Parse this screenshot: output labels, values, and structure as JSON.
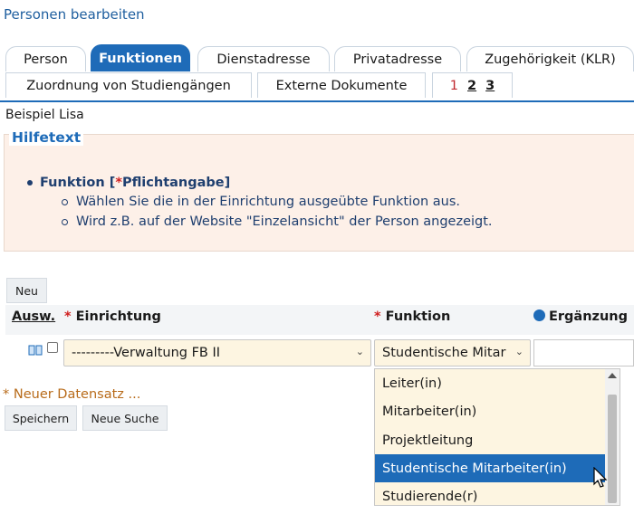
{
  "page_title": "Personen bearbeiten",
  "tabs": [
    {
      "label": "Person"
    },
    {
      "label": "Funktionen"
    },
    {
      "label": "Dienstadresse"
    },
    {
      "label": "Privatadresse"
    },
    {
      "label": "Zugehörigkeit (KLR)"
    }
  ],
  "tabs_row2": [
    {
      "label": "Zuordnung von Studiengängen"
    },
    {
      "label": "Externe Dokumente"
    }
  ],
  "pagination": [
    "1",
    "2",
    "3"
  ],
  "person_name": "Beispiel Lisa",
  "help": {
    "legend": "Hilfetext",
    "item_label": "Funktion [",
    "required_marker": "*",
    "item_label_suffix": "Pflichtangabe]",
    "lines": [
      "Wählen Sie die in der Einrichtung ausgeübte Funktion aus.",
      "Wird z.B. auf der Website \"Einzelansicht\" der Person angezeigt."
    ]
  },
  "buttons": {
    "new": "Neu",
    "save": "Speichern",
    "new_search": "Neue Suche"
  },
  "table": {
    "col_select": "Ausw.",
    "col_institution": "Einrichtung",
    "col_function": "Funktion",
    "col_supplement": "Ergänzung",
    "required_marker": "*"
  },
  "row": {
    "institution_value": "---------Verwaltung FB II",
    "function_value": "Studentische Mitar"
  },
  "new_record": "* Neuer Datensatz ...",
  "dropdown_options": [
    "Leiter(in)",
    "Mitarbeiter(in)",
    "Projektleitung",
    "Studentische Mitarbeiter(in)",
    "Studierende(r)"
  ],
  "selected_option": "Studentische Mitarbeiter(in)",
  "colors": {
    "accent": "#1e6bb8",
    "help_bg": "#fdf0e8",
    "select_bg": "#fdf5e1",
    "required": "#d02020"
  }
}
